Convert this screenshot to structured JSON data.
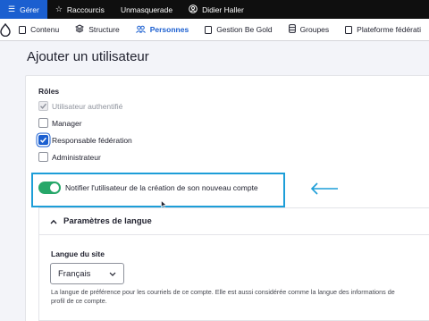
{
  "toolbar": {
    "items": [
      {
        "label": "Gérer",
        "icon": "menu-icon",
        "active": true
      },
      {
        "label": "Raccourcis",
        "icon": "star-icon"
      },
      {
        "label": "Unmasquerade"
      },
      {
        "label": "Didier Haller",
        "icon": "user-icon"
      }
    ],
    "accent": "#1b5fd0"
  },
  "tray": {
    "logo_icon": "drupal-drop-icon",
    "items": [
      {
        "label": "Contenu",
        "icon": "document-icon"
      },
      {
        "label": "Structure",
        "icon": "layers-icon"
      },
      {
        "label": "Personnes",
        "icon": "people-icon",
        "active": true
      },
      {
        "label": "Gestion Be Gold",
        "icon": "checkbox-icon"
      },
      {
        "label": "Groupes",
        "icon": "database-icon"
      },
      {
        "label": "Plateforme fédérati",
        "icon": "checkbox-icon"
      }
    ]
  },
  "page": {
    "title": "Ajouter un utilisateur"
  },
  "roles": {
    "label": "Rôles",
    "options": [
      {
        "label": "Utilisateur authentifié",
        "checked": true,
        "disabled": true
      },
      {
        "label": "Manager",
        "checked": false
      },
      {
        "label": "Responsable fédération",
        "checked": true
      },
      {
        "label": "Administrateur",
        "checked": false
      }
    ]
  },
  "notify": {
    "label": "Notifier l'utilisateur de la création de son nouveau compte",
    "on": true,
    "toggle_color": "#26a769",
    "highlight_color": "#1d9ed8"
  },
  "language": {
    "section_title": "Paramètres de langue",
    "site_label": "Langue du site",
    "selected": "Français",
    "help": "La langue de préférence pour les courriels de ce compte. Elle est aussi considérée comme la langue des informations de profil de ce compte."
  }
}
